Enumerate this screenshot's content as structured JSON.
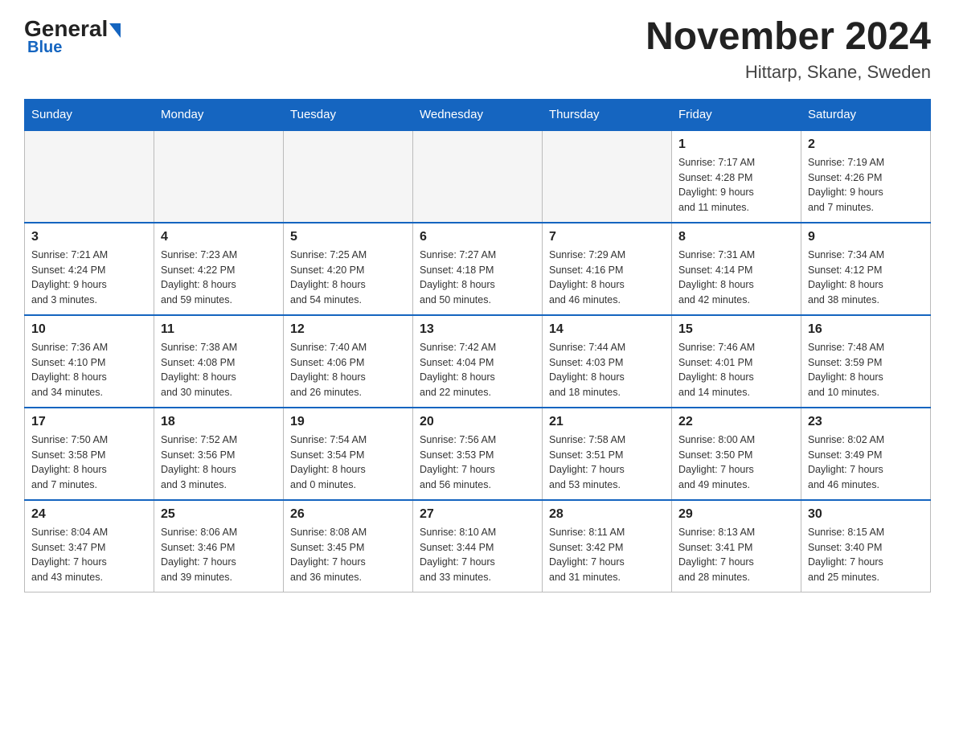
{
  "header": {
    "logo_general": "General",
    "logo_blue": "Blue",
    "month_title": "November 2024",
    "location": "Hittarp, Skane, Sweden"
  },
  "weekdays": [
    "Sunday",
    "Monday",
    "Tuesday",
    "Wednesday",
    "Thursday",
    "Friday",
    "Saturday"
  ],
  "weeks": [
    [
      {
        "day": "",
        "info": ""
      },
      {
        "day": "",
        "info": ""
      },
      {
        "day": "",
        "info": ""
      },
      {
        "day": "",
        "info": ""
      },
      {
        "day": "",
        "info": ""
      },
      {
        "day": "1",
        "info": "Sunrise: 7:17 AM\nSunset: 4:28 PM\nDaylight: 9 hours\nand 11 minutes."
      },
      {
        "day": "2",
        "info": "Sunrise: 7:19 AM\nSunset: 4:26 PM\nDaylight: 9 hours\nand 7 minutes."
      }
    ],
    [
      {
        "day": "3",
        "info": "Sunrise: 7:21 AM\nSunset: 4:24 PM\nDaylight: 9 hours\nand 3 minutes."
      },
      {
        "day": "4",
        "info": "Sunrise: 7:23 AM\nSunset: 4:22 PM\nDaylight: 8 hours\nand 59 minutes."
      },
      {
        "day": "5",
        "info": "Sunrise: 7:25 AM\nSunset: 4:20 PM\nDaylight: 8 hours\nand 54 minutes."
      },
      {
        "day": "6",
        "info": "Sunrise: 7:27 AM\nSunset: 4:18 PM\nDaylight: 8 hours\nand 50 minutes."
      },
      {
        "day": "7",
        "info": "Sunrise: 7:29 AM\nSunset: 4:16 PM\nDaylight: 8 hours\nand 46 minutes."
      },
      {
        "day": "8",
        "info": "Sunrise: 7:31 AM\nSunset: 4:14 PM\nDaylight: 8 hours\nand 42 minutes."
      },
      {
        "day": "9",
        "info": "Sunrise: 7:34 AM\nSunset: 4:12 PM\nDaylight: 8 hours\nand 38 minutes."
      }
    ],
    [
      {
        "day": "10",
        "info": "Sunrise: 7:36 AM\nSunset: 4:10 PM\nDaylight: 8 hours\nand 34 minutes."
      },
      {
        "day": "11",
        "info": "Sunrise: 7:38 AM\nSunset: 4:08 PM\nDaylight: 8 hours\nand 30 minutes."
      },
      {
        "day": "12",
        "info": "Sunrise: 7:40 AM\nSunset: 4:06 PM\nDaylight: 8 hours\nand 26 minutes."
      },
      {
        "day": "13",
        "info": "Sunrise: 7:42 AM\nSunset: 4:04 PM\nDaylight: 8 hours\nand 22 minutes."
      },
      {
        "day": "14",
        "info": "Sunrise: 7:44 AM\nSunset: 4:03 PM\nDaylight: 8 hours\nand 18 minutes."
      },
      {
        "day": "15",
        "info": "Sunrise: 7:46 AM\nSunset: 4:01 PM\nDaylight: 8 hours\nand 14 minutes."
      },
      {
        "day": "16",
        "info": "Sunrise: 7:48 AM\nSunset: 3:59 PM\nDaylight: 8 hours\nand 10 minutes."
      }
    ],
    [
      {
        "day": "17",
        "info": "Sunrise: 7:50 AM\nSunset: 3:58 PM\nDaylight: 8 hours\nand 7 minutes."
      },
      {
        "day": "18",
        "info": "Sunrise: 7:52 AM\nSunset: 3:56 PM\nDaylight: 8 hours\nand 3 minutes."
      },
      {
        "day": "19",
        "info": "Sunrise: 7:54 AM\nSunset: 3:54 PM\nDaylight: 8 hours\nand 0 minutes."
      },
      {
        "day": "20",
        "info": "Sunrise: 7:56 AM\nSunset: 3:53 PM\nDaylight: 7 hours\nand 56 minutes."
      },
      {
        "day": "21",
        "info": "Sunrise: 7:58 AM\nSunset: 3:51 PM\nDaylight: 7 hours\nand 53 minutes."
      },
      {
        "day": "22",
        "info": "Sunrise: 8:00 AM\nSunset: 3:50 PM\nDaylight: 7 hours\nand 49 minutes."
      },
      {
        "day": "23",
        "info": "Sunrise: 8:02 AM\nSunset: 3:49 PM\nDaylight: 7 hours\nand 46 minutes."
      }
    ],
    [
      {
        "day": "24",
        "info": "Sunrise: 8:04 AM\nSunset: 3:47 PM\nDaylight: 7 hours\nand 43 minutes."
      },
      {
        "day": "25",
        "info": "Sunrise: 8:06 AM\nSunset: 3:46 PM\nDaylight: 7 hours\nand 39 minutes."
      },
      {
        "day": "26",
        "info": "Sunrise: 8:08 AM\nSunset: 3:45 PM\nDaylight: 7 hours\nand 36 minutes."
      },
      {
        "day": "27",
        "info": "Sunrise: 8:10 AM\nSunset: 3:44 PM\nDaylight: 7 hours\nand 33 minutes."
      },
      {
        "day": "28",
        "info": "Sunrise: 8:11 AM\nSunset: 3:42 PM\nDaylight: 7 hours\nand 31 minutes."
      },
      {
        "day": "29",
        "info": "Sunrise: 8:13 AM\nSunset: 3:41 PM\nDaylight: 7 hours\nand 28 minutes."
      },
      {
        "day": "30",
        "info": "Sunrise: 8:15 AM\nSunset: 3:40 PM\nDaylight: 7 hours\nand 25 minutes."
      }
    ]
  ]
}
